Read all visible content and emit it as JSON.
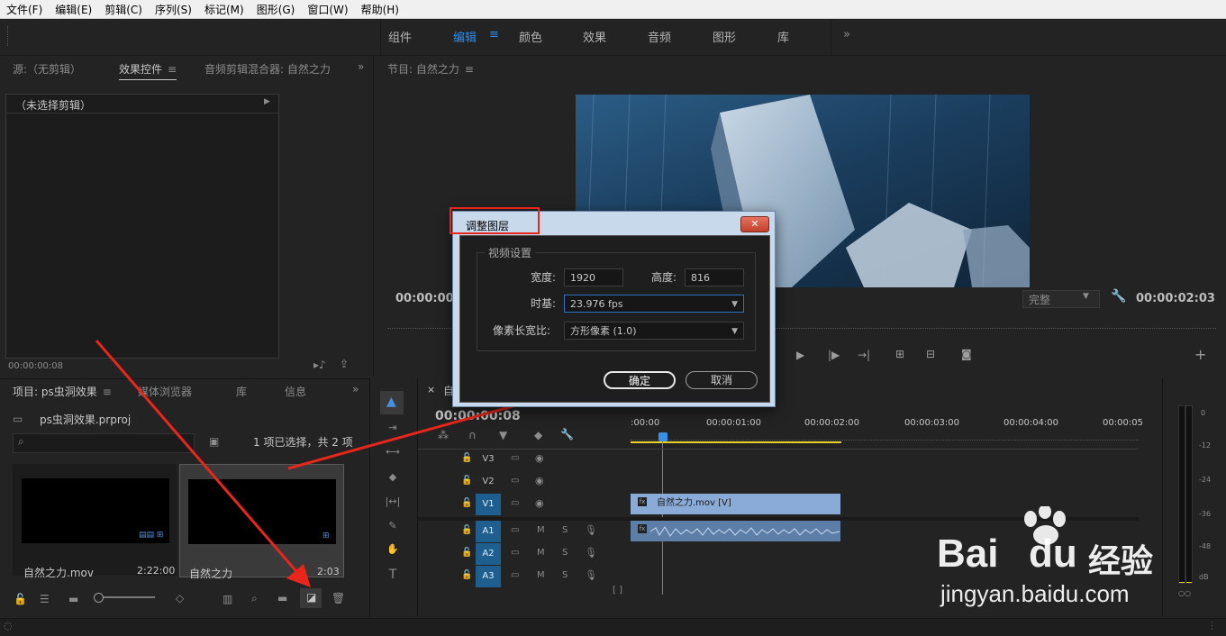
{
  "menubar": [
    "文件(F)",
    "编辑(E)",
    "剪辑(C)",
    "序列(S)",
    "标记(M)",
    "图形(G)",
    "窗口(W)",
    "帮助(H)"
  ],
  "workspaces": {
    "tabs": [
      "组件",
      "编辑",
      "颜色",
      "效果",
      "音频",
      "图形",
      "库"
    ],
    "active": "编辑",
    "more": "»"
  },
  "source_panel": {
    "tab_source": "源:（无剪辑）",
    "tab_effects": "效果控件",
    "tab_mixer": "音频剪辑混合器: 自然之力",
    "no_clip": "（未选择剪辑）",
    "timecode": "00:00:00:08"
  },
  "program_panel": {
    "tab": "节目: 自然之力",
    "timecode_left": "00:00:00:",
    "timecode_right": "00:00:02:03",
    "quality": "完整"
  },
  "project_panel": {
    "tab_project": "项目: ps虫洞效果",
    "tab_media": "媒体浏览器",
    "tab_library": "库",
    "tab_info": "信息",
    "file": "ps虫洞效果.prproj",
    "selection": "1 项已选择，共 2 项",
    "items": [
      {
        "name": "自然之力.mov",
        "duration": "2:22:00"
      },
      {
        "name": "自然之力",
        "duration": "2:03"
      }
    ]
  },
  "timeline": {
    "close": "×",
    "tab": "自",
    "timecode": "00:00:00:08",
    "ruler": [
      ":00:00",
      "00:00:01:00",
      "00:00:02:00",
      "00:00:03:00",
      "00:00:04:00",
      "00:00:05"
    ],
    "tracks_video": [
      "V3",
      "V2",
      "V1"
    ],
    "tracks_audio": [
      "A1",
      "A2",
      "A3"
    ],
    "clip_video": "自然之力.mov [V]",
    "mute": "M",
    "solo": "S"
  },
  "meter": {
    "scale": [
      "0",
      "-12",
      "-24",
      "-36",
      "-48",
      "dB"
    ]
  },
  "dialog": {
    "title": "调整图层",
    "close": "✕",
    "group": "视频设置",
    "width_label": "宽度:",
    "width_value": "1920",
    "height_label": "高度:",
    "height_value": "816",
    "timebase_label": "时基:",
    "timebase_value": "23.976 fps",
    "par_label": "像素长宽比:",
    "par_value": "方形像素 (1.0)",
    "ok": "确定",
    "cancel": "取消"
  },
  "watermark": {
    "brand": "Bai",
    "brand2": "du",
    "cn": "经验",
    "url": "jingyan.baidu.com"
  },
  "colors": {
    "accent": "#2d8ceb",
    "track_blue": "#1f5f8f",
    "clip": "#8aaad7",
    "arrow": "#e8261b",
    "playhead": "#3a8fe8"
  }
}
